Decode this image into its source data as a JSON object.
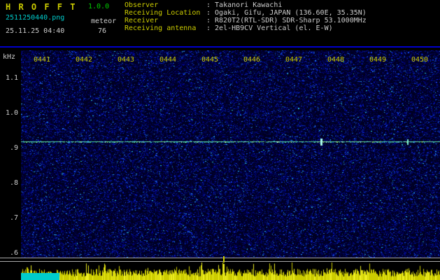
{
  "app": {
    "title": "H R O F F T",
    "version": "1.0.0",
    "filename": "2511250440.png",
    "mode": "meteor",
    "datetime": "25.11.25 04:40",
    "count": "76"
  },
  "info": {
    "colon": ":",
    "rows": [
      {
        "label": "Observer",
        "value": "Takanori Kawachi"
      },
      {
        "label": "Receiving Location",
        "value": "Ogaki, Gifu, JAPAN (136.60E, 35.35N)"
      },
      {
        "label": "Receiver",
        "value": "R820T2(RTL-SDR) SDR-Sharp 53.1000MHz"
      },
      {
        "label": "Receiving antenna",
        "value": "2el-HB9CV Vertical (el. E-W)"
      }
    ]
  },
  "chart_data": {
    "type": "heatmap",
    "subtype": "radio-meteor-spectrogram",
    "x_axis_position": "top",
    "x_ticks": [
      "0441",
      "0442",
      "0443",
      "0444",
      "0445",
      "0446",
      "0447",
      "0448",
      "0449",
      "0450"
    ],
    "y_unit": "kHz",
    "y_ticks": [
      "1.1",
      "1.0",
      ".9",
      ".8",
      ".7",
      ".6"
    ],
    "y_range_khz": [
      0.59,
      1.18
    ],
    "carrier_line_khz": 0.92,
    "carrier_line_description": "continuous cyan-green carrier trace across all 10 minutes",
    "echo_blips_near": [
      "0447-0448",
      "0449"
    ],
    "background_texture": "dark blue random noise speckle",
    "level_strip": "yellow noise-level histogram along bottom edge with cyan marker block at lower left and a tall tick near 0445-0446",
    "grid": false,
    "legend": false
  },
  "colors": {
    "background": "#000000",
    "title": "#cccc00",
    "version": "#00cc00",
    "filename": "#00cccc",
    "info_label": "#cccc00",
    "info_value": "#cccccc",
    "axis_label": "#cccccc",
    "time_tick": "#cccc00",
    "separator_line": "#0000cc",
    "noise_base": "#000022",
    "carrier_line": "#44ccaa",
    "level_bar": "#cccc00",
    "marker_block": "#00cccc",
    "scale_line": "#aaaaaa"
  }
}
